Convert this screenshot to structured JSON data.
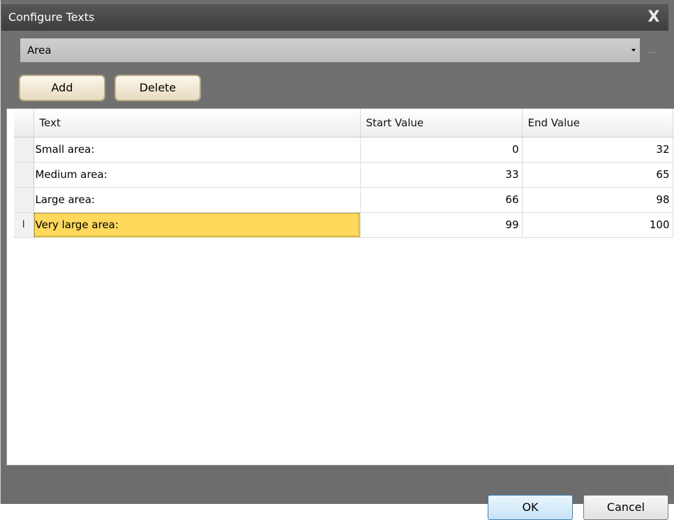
{
  "window": {
    "title": "Configure Texts",
    "close_glyph": "X"
  },
  "selector": {
    "value": "Area",
    "ellipsis": "..."
  },
  "toolbar": {
    "add_label": "Add",
    "delete_label": "Delete"
  },
  "grid": {
    "columns": [
      "Text",
      "Start Value",
      "End Value"
    ],
    "rows": [
      {
        "text": "Small area:",
        "start": "0",
        "end": "32"
      },
      {
        "text": "Medium area:",
        "start": "33",
        "end": "65"
      },
      {
        "text": "Large area:",
        "start": "66",
        "end": "98"
      },
      {
        "text": "Very large area:",
        "start": "99",
        "end": "100",
        "indicator": "I"
      }
    ]
  },
  "footer": {
    "ok_label": "OK",
    "cancel_label": "Cancel"
  },
  "colors": {
    "selected_cell": "#ffd85c",
    "title_bar": "#474747",
    "panel": "#707070"
  }
}
